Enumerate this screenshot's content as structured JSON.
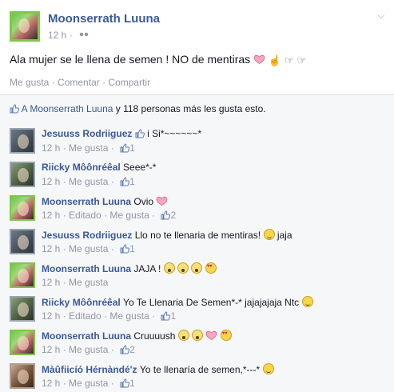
{
  "post": {
    "author": "Moonserrath Luuna",
    "time": "12 h",
    "text": "Ala mujer se le llena de semen ! NO de mentiras",
    "actions": [
      "Me gusta",
      "Comentar",
      "Compartir"
    ],
    "likes_summary_link": "A Moonserrath Luuna",
    "likes_summary_text": " y 118 personas más les gusta esto."
  },
  "icons": {
    "privacy": "friends-icon",
    "menu": "chevron-down-icon",
    "like": "thumbs-up-icon"
  },
  "colors": {
    "link": "#3b5998",
    "meta": "#9197a3",
    "bg": "#f6f7f9"
  },
  "comments": [
    {
      "author": "Jesuuss Rodriiguez",
      "text": "i Si*~~~~~~*",
      "time": "12 h",
      "edited": "",
      "like": "Me gusta",
      "likes": "1"
    },
    {
      "author": "Riicky Môônréêal",
      "text": "Seee*-*",
      "time": "12 h",
      "edited": "",
      "like": "Me gusta",
      "likes": "1"
    },
    {
      "author": "Moonserrath Luuna",
      "text": "Ovio",
      "time": "12 h",
      "edited": "Editado",
      "like": "Me gusta",
      "likes": "2"
    },
    {
      "author": "Jesuuss Rodriiguez",
      "text": "Llo no te llenaria de mentiras!",
      "text2": "jaja",
      "time": "12 h",
      "edited": "",
      "like": "Me gusta",
      "likes": "1"
    },
    {
      "author": "Moonserrath Luuna",
      "text": "JAJA !",
      "time": "12 h",
      "edited": "",
      "like": "Me gusta",
      "likes": ""
    },
    {
      "author": "Riicky Môônréêal",
      "text": "Yo Te Llenaria De Semen*-* jajajajaja Ntc",
      "time": "12 h",
      "edited": "Editado",
      "like": "Me gusta",
      "likes": "1"
    },
    {
      "author": "Moonserrath Luuna",
      "text": "Cruuuush",
      "time": "12 h",
      "edited": "",
      "like": "Me gusta",
      "likes": "2"
    },
    {
      "author": "Màûfiicíó Hérnàndé'z",
      "text": "Yo te llenaría de semen,*---*",
      "time": "12 h",
      "edited": "",
      "like": "Me gusta",
      "likes": "1"
    }
  ]
}
